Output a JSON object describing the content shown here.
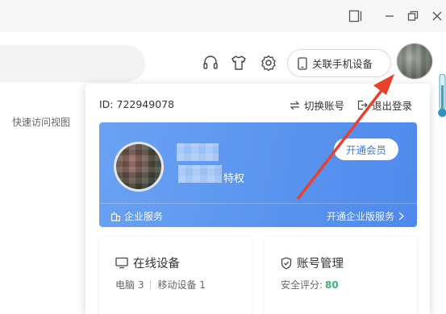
{
  "window": {
    "controls": [
      "sidebar-toggle-icon",
      "minimize-icon",
      "restore-icon",
      "close-icon"
    ]
  },
  "toolbar": {
    "icons": [
      "headset-icon",
      "tshirt-icon",
      "gear-icon"
    ],
    "link_device_label": "关联手机设备"
  },
  "sidebar": {
    "quick_view_label": "快速访问视图"
  },
  "account_panel": {
    "user_id": "ID: 722949078",
    "switch_account_label": "切换账号",
    "logout_label": "退出登录",
    "vip_card": {
      "privilege_text": "特权",
      "open_vip_button": "开通会员",
      "enterprise_service_label": "企业服务",
      "open_enterprise_label": "开通企业版服务"
    },
    "online_devices": {
      "title": "在线设备",
      "pc_label": "电脑 3",
      "mobile_label": "移动设备 1"
    },
    "account_management": {
      "title": "账号管理",
      "security_label": "安全评分:",
      "security_score": "80"
    }
  },
  "colors": {
    "card_blue": "#5b94ef",
    "vip_button_text": "#3b7de9",
    "score_green": "#3cb371",
    "annotation_arrow": "#e8412c"
  }
}
